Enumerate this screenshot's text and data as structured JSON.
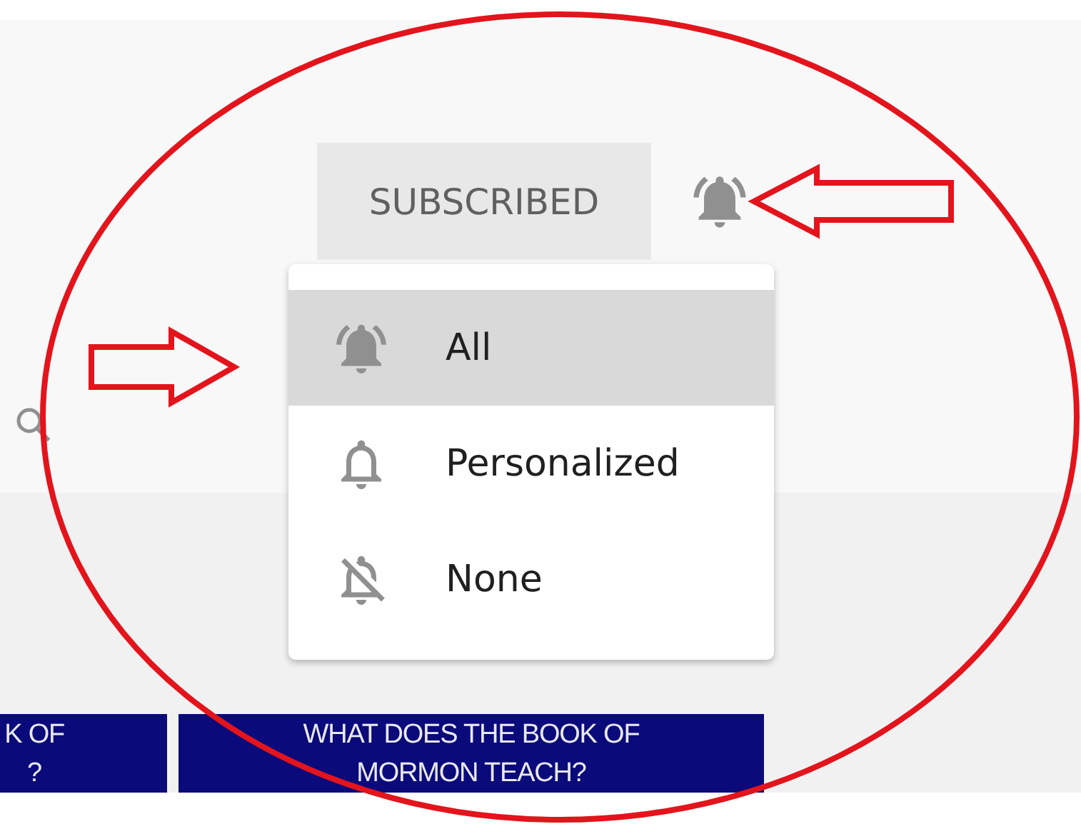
{
  "header": {
    "subscribe_button": {
      "label": "SUBSCRIBED"
    }
  },
  "notification_menu": {
    "items": [
      {
        "label": "All",
        "kind": "ringing",
        "selected": true
      },
      {
        "label": "Personalized",
        "kind": "outline",
        "selected": false
      },
      {
        "label": "None",
        "kind": "off",
        "selected": false
      }
    ]
  },
  "banners": [
    {
      "lines": [
        "K OF",
        "?"
      ]
    },
    {
      "lines": [
        "WHAT DOES THE BOOK OF",
        "MORMON TEACH?"
      ]
    }
  ]
}
